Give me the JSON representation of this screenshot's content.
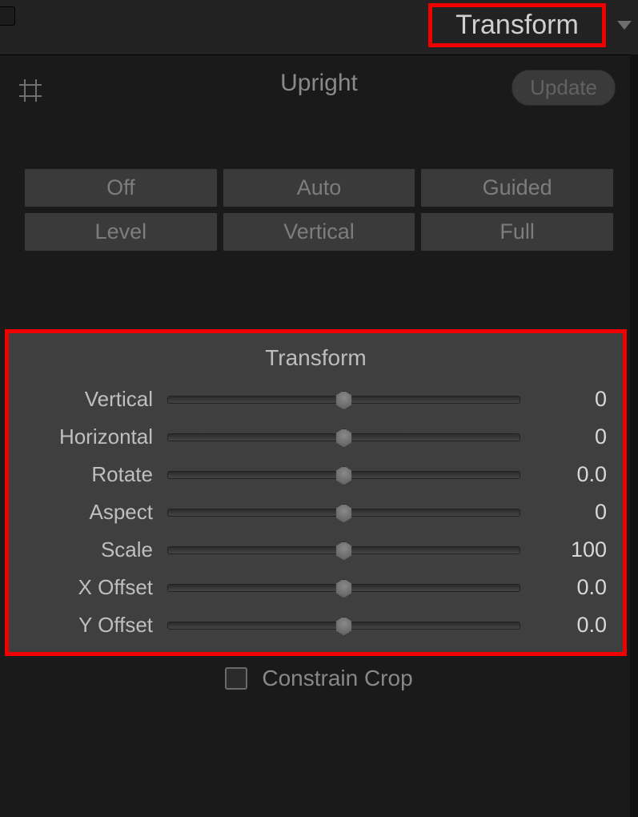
{
  "header": {
    "title": "Transform"
  },
  "upright": {
    "label": "Upright",
    "update_label": "Update",
    "modes": [
      "Off",
      "Auto",
      "Guided",
      "Level",
      "Vertical",
      "Full"
    ]
  },
  "transform": {
    "title": "Transform",
    "sliders": [
      {
        "label": "Vertical",
        "value": "0"
      },
      {
        "label": "Horizontal",
        "value": "0"
      },
      {
        "label": "Rotate",
        "value": "0.0"
      },
      {
        "label": "Aspect",
        "value": "0"
      },
      {
        "label": "Scale",
        "value": "100"
      },
      {
        "label": "X Offset",
        "value": "0.0"
      },
      {
        "label": "Y Offset",
        "value": "0.0"
      }
    ]
  },
  "constrain_crop": {
    "label": "Constrain Crop",
    "checked": false
  }
}
